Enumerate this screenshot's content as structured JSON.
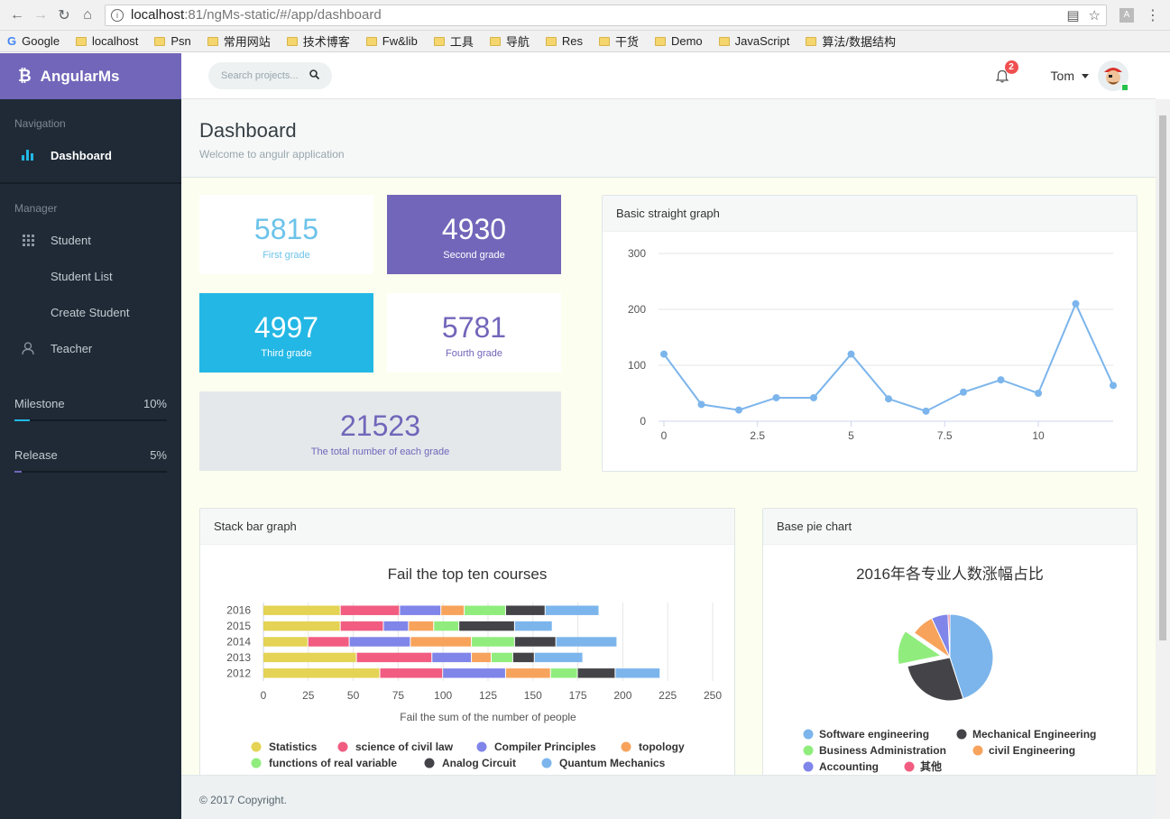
{
  "browser": {
    "url_host": "localhost",
    "url_path": ":81/ngMs-static/#/app/dashboard",
    "bookmarks": [
      "Google",
      "localhost",
      "Psn",
      "常用网站",
      "技术博客",
      "Fw&lib",
      "工具",
      "导航",
      "Res",
      "干货",
      "Demo",
      "JavaScript",
      "算法/数据结构"
    ]
  },
  "sidebar": {
    "brand": "AngularMs",
    "nav_title": "Navigation",
    "nav_items": [
      {
        "label": "Dashboard",
        "icon": "bar-chart-icon"
      }
    ],
    "manager_title": "Manager",
    "manager_items": [
      {
        "label": "Student",
        "icon": "grid-icon"
      },
      {
        "label": "Student List",
        "sub": true
      },
      {
        "label": "Create Student",
        "sub": true
      },
      {
        "label": "Teacher",
        "icon": "user-icon"
      }
    ],
    "progress": [
      {
        "label": "Milestone",
        "value_text": "10%",
        "fraction": 0.1,
        "color": "#23b7e5"
      },
      {
        "label": "Release",
        "value_text": "5%",
        "fraction": 0.05,
        "color": "#7266ba"
      }
    ]
  },
  "header": {
    "search_placeholder": "Search projects...",
    "notifications": "2",
    "user": "Tom"
  },
  "page": {
    "title": "Dashboard",
    "subtitle": "Welcome to angulr application"
  },
  "stats": [
    {
      "value": "5815",
      "label": "First grade",
      "bg": "#ffffff",
      "color": "#6cc3ea"
    },
    {
      "value": "4930",
      "label": "Second grade",
      "bg": "#7266ba",
      "color": "#ffffff"
    },
    {
      "value": "4997",
      "label": "Third grade",
      "bg": "#23b7e5",
      "color": "#ffffff"
    },
    {
      "value": "5781",
      "label": "Fourth grade",
      "bg": "#ffffff",
      "color": "#7266ba"
    },
    {
      "value": "21523",
      "label": "The total number of each grade",
      "bg": "#e4e8eb",
      "color": "#7266ba"
    }
  ],
  "panels": {
    "line": "Basic straight graph",
    "bar": "Stack bar graph",
    "pie": "Base pie chart"
  },
  "footer": "© 2017 Copyright.",
  "chart_data": [
    {
      "type": "line",
      "title": "",
      "x": [
        0,
        1,
        2,
        3,
        4,
        5,
        6,
        7,
        8,
        9,
        10,
        11,
        12
      ],
      "values": [
        120,
        30,
        20,
        42,
        42,
        120,
        40,
        18,
        52,
        74,
        50,
        210,
        64
      ],
      "ylim": [
        0,
        300
      ],
      "yticks": [
        0,
        100,
        200,
        300
      ],
      "xticks": [
        0,
        2.5,
        5,
        7.5,
        10
      ],
      "color": "#7cb5ec",
      "grid": true
    },
    {
      "type": "bar",
      "title": "Fail the top ten courses",
      "xlabel": "Fail the sum of the number of people",
      "orientation": "horizontal",
      "stacked": true,
      "categories": [
        "2012",
        "2013",
        "2014",
        "2015",
        "2016"
      ],
      "xlim": [
        0,
        250
      ],
      "xticks": [
        0,
        25,
        50,
        75,
        100,
        125,
        150,
        175,
        200,
        225,
        250
      ],
      "series": [
        {
          "name": "Statistics",
          "color": "#e4d354",
          "values": [
            65,
            52,
            25,
            43,
            43
          ]
        },
        {
          "name": "science of civil law",
          "color": "#f15c80",
          "values": [
            35,
            42,
            23,
            24,
            33
          ]
        },
        {
          "name": "Compiler Principles",
          "color": "#8085e9",
          "values": [
            35,
            22,
            34,
            14,
            23
          ]
        },
        {
          "name": "topology",
          "color": "#f7a35c",
          "values": [
            25,
            11,
            34,
            14,
            13
          ]
        },
        {
          "name": "functions of real variable",
          "color": "#90ed7d",
          "values": [
            15,
            12,
            24,
            14,
            23
          ]
        },
        {
          "name": "Analog Circuit",
          "color": "#434348",
          "values": [
            21,
            12,
            23,
            31,
            22
          ]
        },
        {
          "name": "Quantum Mechanics",
          "color": "#7cb5ec",
          "values": [
            25,
            27,
            34,
            21,
            30
          ]
        }
      ]
    },
    {
      "type": "pie",
      "title": "2016年各专业人数涨幅占比",
      "slices": [
        {
          "name": "Software engineering",
          "value": 45,
          "color": "#7cb5ec"
        },
        {
          "name": "Mechanical Engineering",
          "value": 26.8,
          "color": "#434348"
        },
        {
          "name": "Business Administration",
          "value": 12.8,
          "color": "#90ed7d",
          "sliced": true
        },
        {
          "name": "civil Engineering",
          "value": 8.5,
          "color": "#f7a35c"
        },
        {
          "name": "Accounting",
          "value": 6.2,
          "color": "#8085e9"
        },
        {
          "name": "其他",
          "value": 0.7,
          "color": "#f15c80"
        }
      ]
    }
  ]
}
